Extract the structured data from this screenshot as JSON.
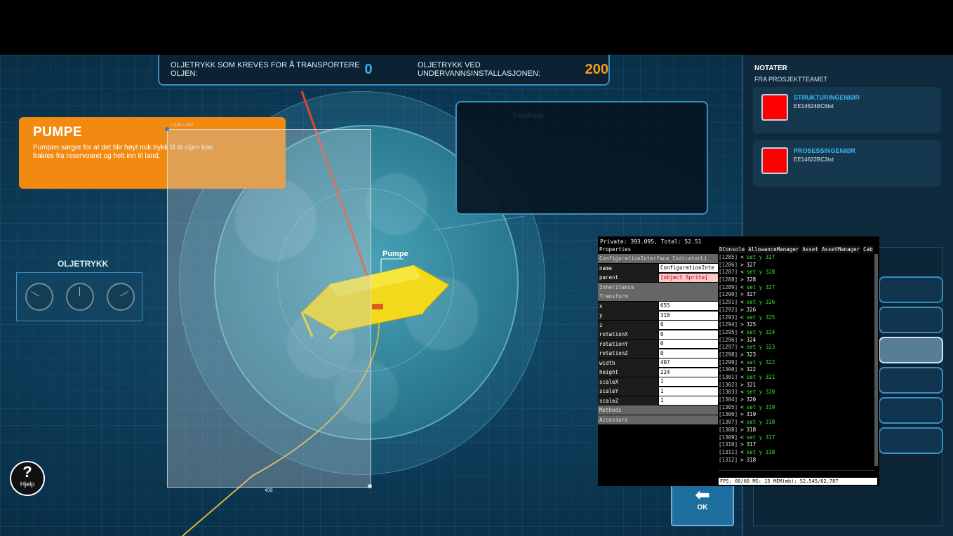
{
  "topbar": {
    "required_label": "OLJETRYKK SOM KREVES FOR Å TRANSPORTERE OLJEN:",
    "required_value": "0",
    "subsea_label": "OLJETRYKK VED UNDERVANNSINSTALLASJONEN:",
    "subsea_value": "200"
  },
  "info_card": {
    "title": "PUMPE",
    "text": "Pumpen sørger for at det blir høyt nok trykk til at oljen kan fraktes fra reservoaret og helt inn til land."
  },
  "selection": {
    "top_label": "+ 238 × 390",
    "bottom_label": "408"
  },
  "feedback": {
    "label": "Feedback"
  },
  "scene": {
    "pump_label": "Pumpe"
  },
  "oil_pressure": {
    "title": "OLJETRYKK",
    "gauge_count": 3
  },
  "help": {
    "symbol": "?",
    "label": "Hjelp"
  },
  "notes": {
    "title": "NOTATER",
    "subtitle": "FRA PROSJEKTTEAMET",
    "items": [
      {
        "role": "STRUKTURINGENIØR",
        "file": "EE14624BC6txt",
        "color": "#ff0000"
      },
      {
        "role": "PROSESSINGENIØR",
        "file": "EE14622BC3txt",
        "color": "#ff0000"
      }
    ]
  },
  "ok_button": {
    "label": "OK",
    "icon": "arrow-left-icon"
  },
  "debug": {
    "header": "Private: 393.095, Total: 52.51",
    "properties_title": "Properties",
    "tabs": [
      "DConsole",
      "AllowanceManager",
      "Asset",
      "AssetManager",
      "Cab"
    ],
    "props": [
      {
        "k": "ConfigurationInterface_IndicatorLi",
        "v": "",
        "section": true
      },
      {
        "k": "name",
        "v": "ConfigurationInte"
      },
      {
        "k": "parent",
        "v": "[object Sprite]",
        "pink": true
      },
      {
        "k": "Inheritance",
        "v": "",
        "section": true
      },
      {
        "k": "Transform",
        "v": "",
        "section": true
      },
      {
        "k": "x",
        "v": "655"
      },
      {
        "k": "y",
        "v": "318"
      },
      {
        "k": "z",
        "v": "0"
      },
      {
        "k": "rotationX",
        "v": "0"
      },
      {
        "k": "rotationY",
        "v": "0"
      },
      {
        "k": "rotationZ",
        "v": "0"
      },
      {
        "k": "width",
        "v": "407"
      },
      {
        "k": "height",
        "v": "224"
      },
      {
        "k": "scaleX",
        "v": "1"
      },
      {
        "k": "scaleY",
        "v": "1"
      },
      {
        "k": "scaleZ",
        "v": "1"
      },
      {
        "k": "Methods",
        "v": "",
        "section": true
      },
      {
        "k": "Accessors",
        "v": "",
        "section": true
      }
    ],
    "console": [
      [
        "[1285]",
        "<",
        "set y 327"
      ],
      [
        "[1286]",
        ">",
        "327"
      ],
      [
        "[1287]",
        "<",
        "set y 328"
      ],
      [
        "[1288]",
        ">",
        "328"
      ],
      [
        "[1289]",
        "<",
        "set y 327"
      ],
      [
        "[1290]",
        ">",
        "327"
      ],
      [
        "[1291]",
        "<",
        "set y 326"
      ],
      [
        "[1292]",
        ">",
        "326"
      ],
      [
        "[1293]",
        "<",
        "set y 325"
      ],
      [
        "[1294]",
        ">",
        "325"
      ],
      [
        "[1295]",
        "<",
        "set y 324"
      ],
      [
        "[1296]",
        ">",
        "324"
      ],
      [
        "[1297]",
        "<",
        "set y 323"
      ],
      [
        "[1298]",
        ">",
        "323"
      ],
      [
        "[1299]",
        "<",
        "set y 322"
      ],
      [
        "[1300]",
        ">",
        "322"
      ],
      [
        "[1301]",
        "<",
        "set y 321"
      ],
      [
        "[1302]",
        ">",
        "321"
      ],
      [
        "[1303]",
        "<",
        "set y 320"
      ],
      [
        "[1304]",
        ">",
        "320"
      ],
      [
        "[1305]",
        "<",
        "set y 319"
      ],
      [
        "[1306]",
        ">",
        "319"
      ],
      [
        "[1307]",
        "<",
        "set y 318"
      ],
      [
        "[1308]",
        ">",
        "318"
      ],
      [
        "[1309]",
        "<",
        "set y 317"
      ],
      [
        "[1310]",
        ">",
        "317"
      ],
      [
        "[1311]",
        "<",
        "set y 318"
      ],
      [
        "[1312]",
        ">",
        "318"
      ]
    ],
    "status": "FPS: 60/60 MS: 15 MEM(mb): 52.545/62.787"
  }
}
